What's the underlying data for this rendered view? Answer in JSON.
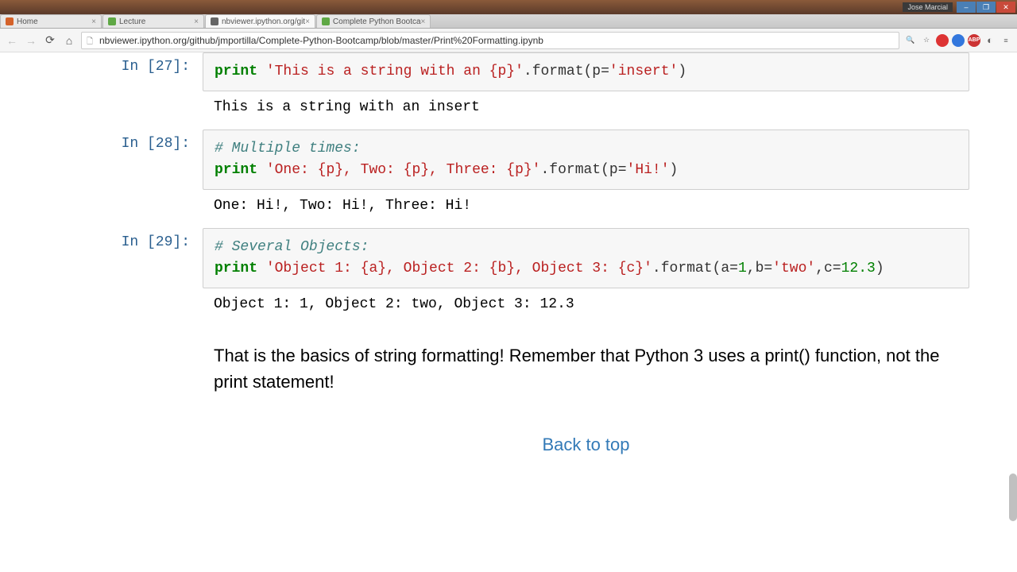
{
  "titlebar": {
    "user": "Jose Marcial"
  },
  "tabs": [
    {
      "label": "Home",
      "favicon": "home"
    },
    {
      "label": "Lecture",
      "favicon": "u"
    },
    {
      "label": "nbviewer.ipython.org/git",
      "favicon": "nb",
      "active": true
    },
    {
      "label": "Complete Python Bootca",
      "favicon": "u"
    }
  ],
  "url": "nbviewer.ipython.org/github/jmportilla/Complete-Python-Bootcamp/blob/master/Print%20Formatting.ipynb",
  "cells": [
    {
      "prompt": "In [27]:",
      "code": {
        "segments": [
          {
            "cls": "kw",
            "t": "print"
          },
          {
            "cls": "pn",
            "t": " "
          },
          {
            "cls": "str",
            "t": "'This is a string with an {p}'"
          },
          {
            "cls": "pn",
            "t": ".format(p="
          },
          {
            "cls": "str",
            "t": "'insert'"
          },
          {
            "cls": "pn",
            "t": ")"
          }
        ]
      },
      "output": "This is a string with an insert"
    },
    {
      "prompt": "In [28]:",
      "code": {
        "segments": [
          {
            "cls": "com",
            "t": "# Multiple times:"
          },
          {
            "cls": "pn",
            "t": "\n"
          },
          {
            "cls": "kw",
            "t": "print"
          },
          {
            "cls": "pn",
            "t": " "
          },
          {
            "cls": "str",
            "t": "'One: {p}, Two: {p}, Three: {p}'"
          },
          {
            "cls": "pn",
            "t": ".format(p="
          },
          {
            "cls": "str",
            "t": "'Hi!'"
          },
          {
            "cls": "pn",
            "t": ")"
          }
        ]
      },
      "output": "One: Hi!, Two: Hi!, Three: Hi!"
    },
    {
      "prompt": "In [29]:",
      "code": {
        "segments": [
          {
            "cls": "com",
            "t": "# Several Objects:"
          },
          {
            "cls": "pn",
            "t": "\n"
          },
          {
            "cls": "kw",
            "t": "print"
          },
          {
            "cls": "pn",
            "t": " "
          },
          {
            "cls": "str",
            "t": "'Object 1: {a}, Object 2: {b}, Object 3: {c}'"
          },
          {
            "cls": "pn",
            "t": ".format(a="
          },
          {
            "cls": "num",
            "t": "1"
          },
          {
            "cls": "pn",
            "t": ",b="
          },
          {
            "cls": "str",
            "t": "'two'"
          },
          {
            "cls": "pn",
            "t": ",c="
          },
          {
            "cls": "num",
            "t": "12.3"
          },
          {
            "cls": "pn",
            "t": ")"
          }
        ]
      },
      "output": "Object 1: 1, Object 2: two, Object 3: 12.3"
    }
  ],
  "text_cell": "That is the basics of string formatting! Remember that Python 3 uses a print() function, not the print statement!",
  "back_to_top": "Back to top"
}
